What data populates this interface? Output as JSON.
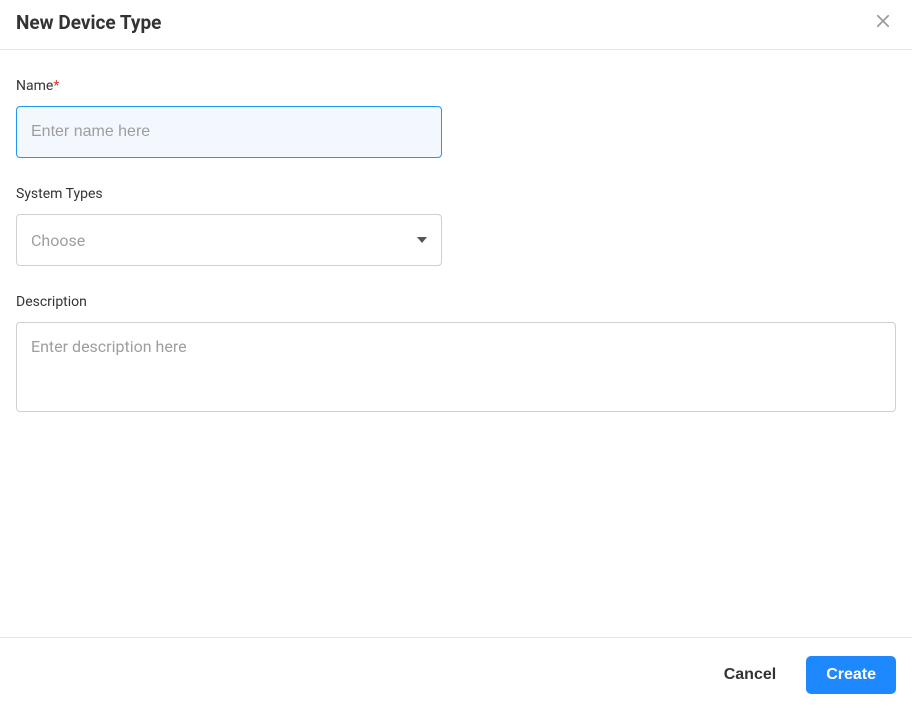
{
  "dialog": {
    "title": "New Device Type"
  },
  "form": {
    "name": {
      "label": "Name",
      "required_mark": "*",
      "placeholder": "Enter name here",
      "value": ""
    },
    "systemTypes": {
      "label": "System Types",
      "placeholder": "Choose"
    },
    "description": {
      "label": "Description",
      "placeholder": "Enter description here",
      "value": ""
    }
  },
  "footer": {
    "cancel": "Cancel",
    "create": "Create"
  }
}
